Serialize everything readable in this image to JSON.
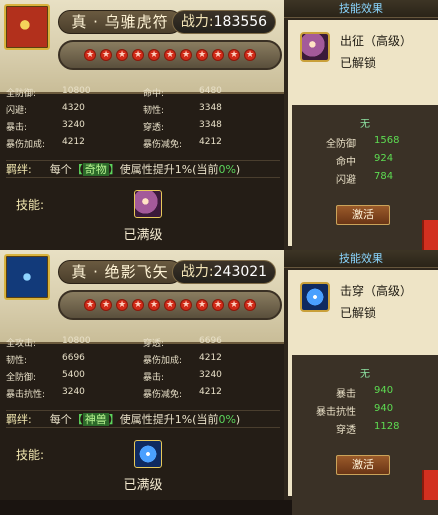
{
  "cards": [
    {
      "name": "真 · 乌骓虎符",
      "power_label": "战力:",
      "power_value": "183556",
      "stars": [
        "★",
        "★",
        "★",
        "★",
        "★",
        "★",
        "★",
        "★",
        "★",
        "★",
        "★"
      ],
      "stats": [
        [
          {
            "k": "全防御:",
            "v": "10800"
          },
          {
            "k": "命中:",
            "v": "6480"
          }
        ],
        [
          {
            "k": "闪避:",
            "v": "4320"
          },
          {
            "k": "韧性:",
            "v": "3348"
          }
        ],
        [
          {
            "k": "暴击:",
            "v": "3240"
          },
          {
            "k": "穿透:",
            "v": "3348"
          }
        ],
        [
          {
            "k": "暴伤加成:",
            "v": "4212"
          },
          {
            "k": "暴伤减免:",
            "v": "4212"
          }
        ]
      ],
      "bond_label": "羁绊:",
      "bond_prefix": "每个",
      "bond_bracket_open": "【",
      "bond_item": "奇物",
      "bond_bracket_close": "】",
      "bond_middle": "使属性提升1%(当前",
      "bond_current": "0%",
      "bond_suffix": ")",
      "skill_label": "技能:",
      "maxed": "已满级"
    },
    {
      "name": "真 · 绝影飞矢",
      "power_label": "战力:",
      "power_value": "243021",
      "stars": [
        "★",
        "★",
        "★",
        "★",
        "★",
        "★",
        "★",
        "★",
        "★",
        "★",
        "★"
      ],
      "stats": [
        [
          {
            "k": "全攻击:",
            "v": "10800"
          },
          {
            "k": "穿透:",
            "v": "6696"
          }
        ],
        [
          {
            "k": "韧性:",
            "v": "6696"
          },
          {
            "k": "暴伤加成:",
            "v": "4212"
          }
        ],
        [
          {
            "k": "全防御:",
            "v": "5400"
          },
          {
            "k": "暴击:",
            "v": "3240"
          }
        ],
        [
          {
            "k": "暴击抗性:",
            "v": "3240"
          },
          {
            "k": "暴伤减免:",
            "v": "4212"
          }
        ]
      ],
      "bond_label": "羁绊:",
      "bond_prefix": "每个",
      "bond_bracket_open": "【",
      "bond_item": "神兽",
      "bond_bracket_close": "】",
      "bond_middle": "使属性提升1%(当前",
      "bond_current": "0%",
      "bond_suffix": ")",
      "skill_label": "技能:",
      "maxed": "已满级"
    }
  ],
  "sides": [
    {
      "title": "技能效果",
      "skill_name": "出征（高级）",
      "state": "已解锁",
      "none": "无",
      "effects": [
        {
          "k": "全防御",
          "v": "1568"
        },
        {
          "k": "命中",
          "v": "924"
        },
        {
          "k": "闪避",
          "v": "784"
        }
      ],
      "button": "激活"
    },
    {
      "title": "技能效果",
      "skill_name": "击穿（高级）",
      "state": "已解锁",
      "none": "无",
      "effects": [
        {
          "k": "暴击",
          "v": "940"
        },
        {
          "k": "暴击抗性",
          "v": "940"
        },
        {
          "k": "穿透",
          "v": "1128"
        }
      ],
      "button": "激活"
    }
  ]
}
